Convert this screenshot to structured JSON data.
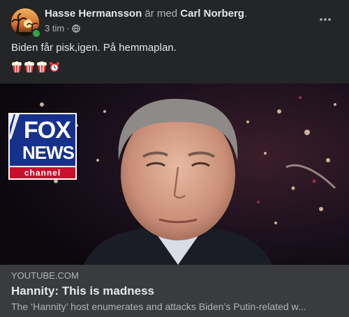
{
  "post": {
    "author": "Hasse Hermansson",
    "with_word": "är med",
    "tagged": "Carl Norberg",
    "period": ".",
    "time": "3 tim",
    "dot": "·",
    "text": "Biden får pisk,igen. På hemmaplan.",
    "emojis": [
      "popcorn-emoji",
      "popcorn-emoji",
      "popcorn-emoji",
      "alarm-clock-emoji"
    ]
  },
  "link": {
    "source": "YOUTUBE.COM",
    "title": "Hannity: This is madness",
    "description": "The ‘Hannity’ host enumerates and attacks Biden’s Putin-related w..."
  },
  "logo": {
    "line1": "FOX",
    "line2": "NEWS",
    "line3": "channel"
  },
  "colors": {
    "background": "#242526",
    "link_box": "#3a3b3c",
    "online": "#31a24c",
    "fox_blue": "#17308a",
    "fox_red": "#c8102e"
  }
}
